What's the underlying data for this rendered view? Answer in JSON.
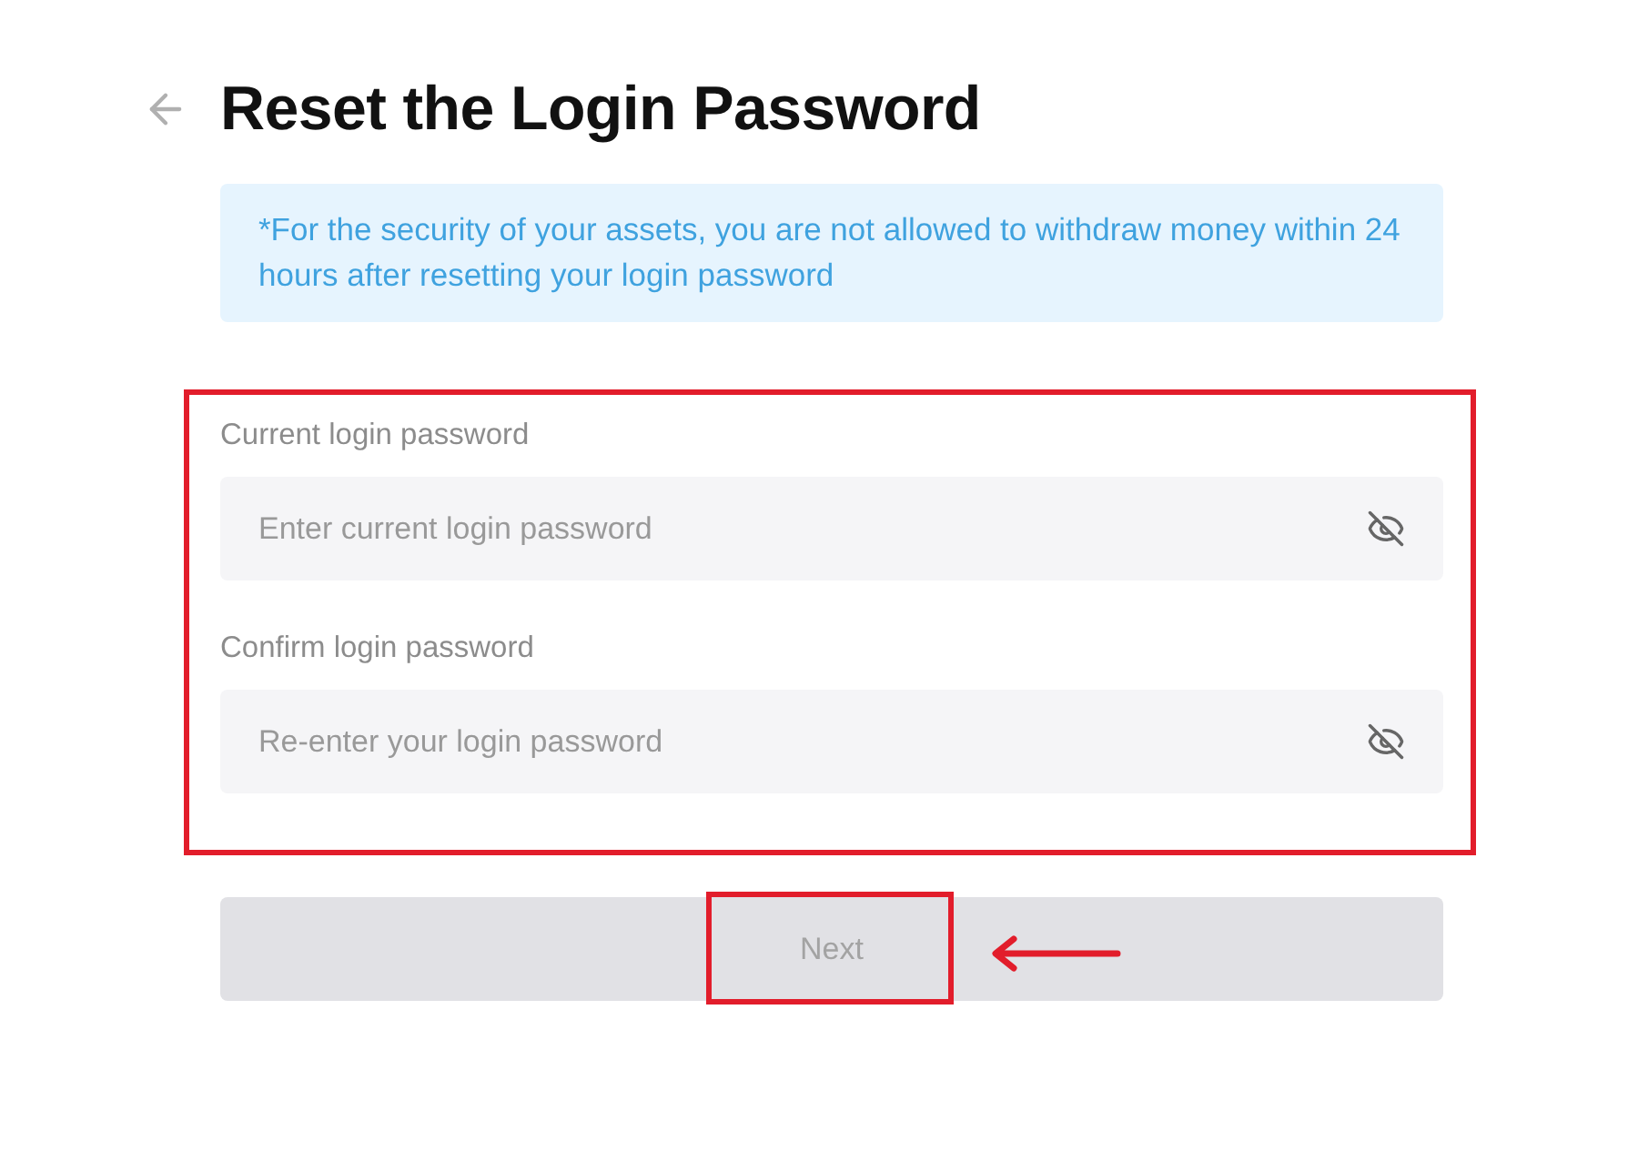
{
  "header": {
    "title": "Reset the Login Password"
  },
  "notice": {
    "text": "*For the security of your assets, you are not allowed to withdraw money within 24 hours after resetting your login password"
  },
  "fields": [
    {
      "label": "Current login password",
      "placeholder": "Enter current login password",
      "revealed": false
    },
    {
      "label": "Confirm login password",
      "placeholder": "Re-enter your login password",
      "revealed": false
    }
  ],
  "next_button": {
    "label": "Next",
    "disabled": true
  }
}
